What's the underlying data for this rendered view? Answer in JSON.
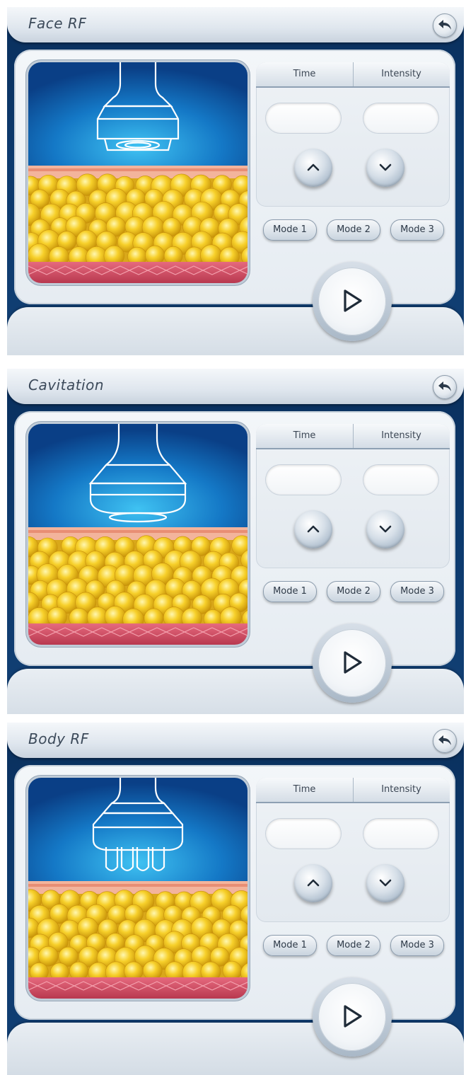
{
  "screens": [
    {
      "title": "Face RF",
      "tabs": {
        "time": "Time",
        "intensity": "Intensity"
      },
      "time_value": "",
      "intensity_value": "",
      "modes": [
        "Mode 1",
        "Mode 2",
        "Mode 3"
      ],
      "handpiece": "rf-ring-handpiece"
    },
    {
      "title": "Cavitation",
      "tabs": {
        "time": "Time",
        "intensity": "Intensity"
      },
      "time_value": "",
      "intensity_value": "",
      "modes": [
        "Mode 1",
        "Mode 2",
        "Mode 3"
      ],
      "handpiece": "cavitation-handpiece"
    },
    {
      "title": "Body RF",
      "tabs": {
        "time": "Time",
        "intensity": "Intensity"
      },
      "time_value": "",
      "intensity_value": "",
      "modes": [
        "Mode 1",
        "Mode 2",
        "Mode 3"
      ],
      "handpiece": "body-rf-multi-tip-handpiece"
    }
  ],
  "icons": {
    "back": "back-arrow-icon",
    "up": "chevron-up-icon",
    "down": "chevron-down-icon",
    "play": "play-icon"
  },
  "colors": {
    "background_dark": "#0c3a6e",
    "illustration_blue": "#1a7fd0",
    "skin_band": "#f0a48c",
    "fat_yellow": "#f7d02a",
    "muscle_red": "#d8556a"
  }
}
